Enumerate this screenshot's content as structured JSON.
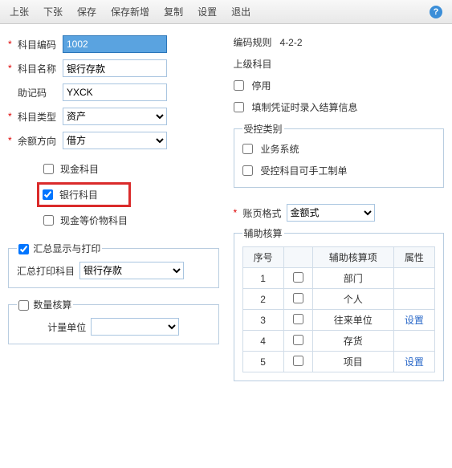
{
  "toolbar": {
    "prev": "上张",
    "next": "下张",
    "save": "保存",
    "saveNew": "保存新增",
    "copy": "复制",
    "settings": "设置",
    "exit": "退出"
  },
  "left": {
    "codeLabel": "科目编码",
    "codeValue": "1002",
    "nameLabel": "科目名称",
    "nameValue": "银行存款",
    "mnemonicLabel": "助记码",
    "mnemonicValue": "YXCK",
    "typeLabel": "科目类型",
    "typeValue": "资产",
    "balanceLabel": "余额方向",
    "balanceValue": "借方",
    "cbCash": "现金科目",
    "cbBank": "银行科目",
    "cbCashEquiv": "现金等价物科目",
    "fsSummary": "汇总显示与打印",
    "summaryPrintLabel": "汇总打印科目",
    "summaryPrintValue": "银行存款",
    "fsQty": "数量核算",
    "qtyUnitLabel": "计量单位",
    "qtyUnitValue": ""
  },
  "right": {
    "codeRuleLabel": "编码规则",
    "codeRuleValue": "4-2-2",
    "parentLabel": "上级科目",
    "cbDisable": "停用",
    "cbFillSettle": "填制凭证时录入结算信息",
    "fsControl": "受控类别",
    "cbBiz": "业务系统",
    "cbManual": "受控科目可手工制单",
    "accFormatLabel": "账页格式",
    "accFormatValue": "金额式",
    "fsAux": "辅助核算",
    "auxHeaders": {
      "seq": "序号",
      "chk": "",
      "item": "辅助核算项",
      "attr": "属性"
    },
    "auxRows": [
      {
        "seq": "1",
        "item": "部门",
        "attr": ""
      },
      {
        "seq": "2",
        "item": "个人",
        "attr": ""
      },
      {
        "seq": "3",
        "item": "往来单位",
        "attr": "设置"
      },
      {
        "seq": "4",
        "item": "存货",
        "attr": ""
      },
      {
        "seq": "5",
        "item": "项目",
        "attr": "设置"
      }
    ]
  }
}
